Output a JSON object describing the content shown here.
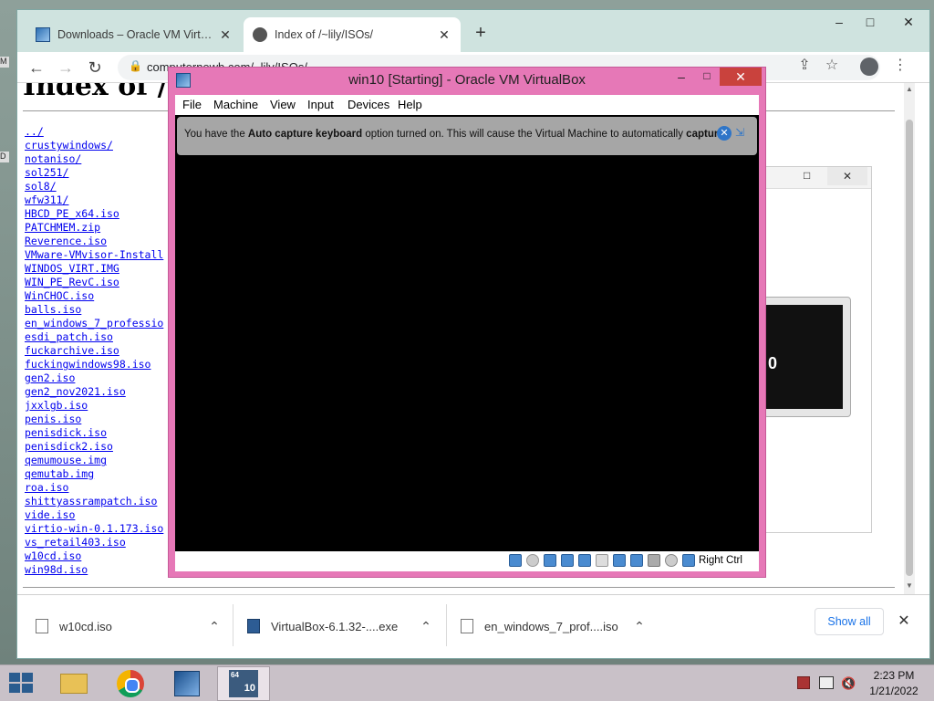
{
  "browser": {
    "tabs": [
      {
        "title": "Downloads – Oracle VM VirtualBox"
      },
      {
        "title": "Index of /~lily/ISOs/"
      }
    ],
    "new_tab": "+",
    "url": "computernewb.com/~lily/ISOs/",
    "window_controls": {
      "minimize": "–",
      "maximize": "□",
      "close": "✕"
    }
  },
  "page": {
    "heading": "Index of /~lily/ISOs/",
    "files": [
      "../",
      "crustywindows/",
      "notaniso/",
      "sol251/",
      "sol8/",
      "wfw311/",
      "HBCD_PE_x64.iso",
      "PATCHMEM.zip",
      "Reverence.iso",
      "VMware-VMvisor-Install",
      "WINDOS_VIRT.IMG",
      "WIN_PE_RevC.iso",
      "WinCHOC.iso",
      "balls.iso",
      "en_windows_7_professio",
      "esdi_patch.iso",
      "fuckarchive.iso",
      "fuckingwindows98.iso",
      "gen2.iso",
      "gen2_nov2021.iso",
      "jxxlgb.iso",
      "penis.iso",
      "penisdick.iso",
      "penisdick2.iso",
      "qemumouse.img",
      "qemutab.img",
      "roa.iso",
      "shittyassrampatch.iso",
      "vide.iso",
      "virtio-win-0.1.173.iso",
      "vs_retail403.iso",
      "w10cd.iso",
      "win98d.iso"
    ]
  },
  "background_window": {
    "preview_text": "0"
  },
  "vm_window": {
    "title": "win10 [Starting] - Oracle VM VirtualBox",
    "menu": [
      "File",
      "Machine",
      "View",
      "Input",
      "Devices",
      "Help"
    ],
    "notice": {
      "pre": "You have the ",
      "bold1": "Auto capture keyboard",
      "mid": " option turned on. This will cause the Virtual Machine to automatically ",
      "bold2": "capture"
    },
    "host_key": "Right Ctrl"
  },
  "downloads": {
    "items": [
      {
        "name": "w10cd.iso"
      },
      {
        "name": "VirtualBox-6.1.32-....exe"
      },
      {
        "name": "en_windows_7_prof....iso"
      }
    ],
    "show_all": "Show all"
  },
  "taskbar": {
    "time": "2:23 PM",
    "date": "1/21/2022",
    "vm_badge_bits": "64",
    "vm_badge_version": "10"
  },
  "colors": {
    "vm_frame": "#e678b7",
    "vm_close": "#c9423d",
    "link": "#0000ee",
    "chrome_frame": "#cfe3df"
  }
}
